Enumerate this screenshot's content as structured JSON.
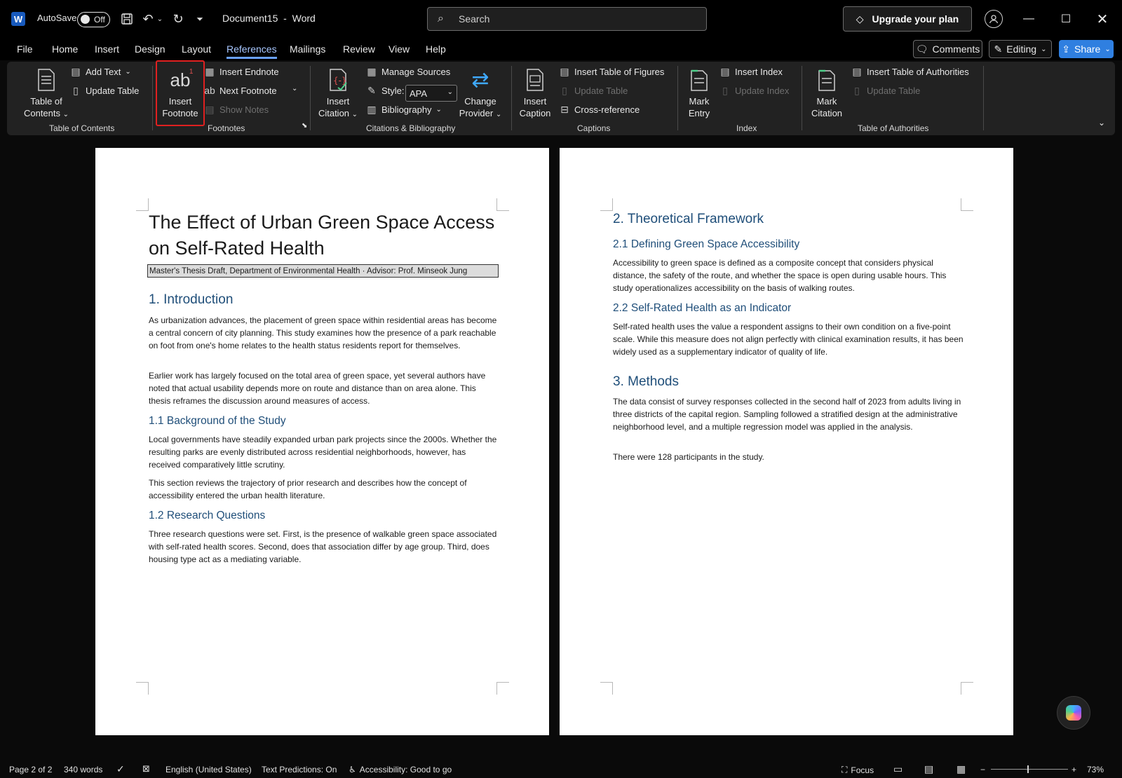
{
  "titlebar": {
    "app_letter": "W",
    "autosave_label": "AutoSave",
    "autosave_state": "Off",
    "document_name": "Document15",
    "separator": "-",
    "app_name": "Word",
    "search_placeholder": "Search",
    "upgrade_label": "Upgrade your plan"
  },
  "menu": {
    "tabs": [
      "File",
      "Home",
      "Insert",
      "Design",
      "Layout",
      "References",
      "Mailings",
      "Review",
      "View",
      "Help"
    ],
    "active_tab": "References",
    "comments_label": "Comments",
    "editing_label": "Editing",
    "share_label": "Share"
  },
  "ribbon": {
    "toc": {
      "table_of_contents": "Table of\nContents",
      "add_text": "Add Text",
      "update_table": "Update Table",
      "group": "Table of Contents"
    },
    "footnotes": {
      "insert_footnote": "Insert\nFootnote",
      "insert_endnote": "Insert Endnote",
      "next_footnote": "Next Footnote",
      "show_notes": "Show Notes",
      "group": "Footnotes"
    },
    "citations": {
      "insert_citation": "Insert\nCitation",
      "manage_sources": "Manage Sources",
      "style_label": "Style:",
      "style_value": "APA",
      "bibliography": "Bibliography",
      "change_provider": "Change\nProvider",
      "group": "Citations & Bibliography"
    },
    "captions": {
      "insert_caption": "Insert\nCaption",
      "insert_table_of_figures": "Insert Table of Figures",
      "update_table": "Update Table",
      "cross_reference": "Cross-reference",
      "group": "Captions"
    },
    "index": {
      "mark_entry": "Mark\nEntry",
      "insert_index": "Insert Index",
      "update_index": "Update Index",
      "group": "Index"
    },
    "authorities": {
      "mark_citation": "Mark\nCitation",
      "insert_table_of_authorities": "Insert Table of Authorities",
      "update_table": "Update Table",
      "group": "Table of Authorities"
    }
  },
  "page1": {
    "title_line1": "The Effect of Urban Green Space Access",
    "title_line2": "on Self-Rated Health",
    "subtitle": "Master's Thesis Draft, Department of Environmental Health · Advisor: Prof. Minseok Jung",
    "h_intro": "1. Introduction",
    "p_intro1": "As urbanization advances, the placement of green space within residential areas has become a central concern of city planning. This study examines how the presence of a park reachable on foot from one's home relates to the health status residents report for themselves.",
    "p_intro2": "Earlier work has largely focused on the total area of green space, yet several authors have noted that actual usability depends more on route and distance than on area alone. This thesis reframes the discussion around measures of access.",
    "h_background": "1.1 Background of the Study",
    "p_background1": "Local governments have steadily expanded urban park projects since the 2000s. Whether the resulting parks are evenly distributed across residential neighborhoods, however, has received comparatively little scrutiny.",
    "p_background2": "This section reviews the trajectory of prior research and describes how the concept of accessibility entered the urban health literature.",
    "h_questions": "1.2 Research Questions",
    "p_questions": "Three research questions were set. First, is the presence of walkable green space associated with self-rated health scores. Second, does that association differ by age group. Third, does housing type act as a mediating variable."
  },
  "page2": {
    "h_framework": "2. Theoretical Framework",
    "h_defining": "2.1 Defining Green Space Accessibility",
    "p_defining": "Accessibility to green space is defined as a composite concept that considers physical distance, the safety of the route, and whether the space is open during usable hours. This study operationalizes accessibility on the basis of walking routes.",
    "h_indicator": "2.2 Self-Rated Health as an Indicator",
    "p_indicator": "Self-rated health uses the value a respondent assigns to their own condition on a five-point scale. While this measure does not align perfectly with clinical examination results, it has been widely used as a supplementary indicator of quality of life.",
    "h_methods": "3. Methods",
    "p_methods": "The data consist of survey responses collected in the second half of 2023 from adults living in three districts of the capital region. Sampling followed a stratified design at the administrative neighborhood level, and a multiple regression model was applied in the analysis.",
    "p_participants": "There were 128 participants in the study."
  },
  "status": {
    "page": "Page 2 of 2",
    "words": "340 words",
    "language": "English (United States)",
    "predictions": "Text Predictions: On",
    "accessibility": "Accessibility: Good to go",
    "focus": "Focus",
    "zoom": "73%",
    "zoom_minus": "−",
    "zoom_plus": "+"
  },
  "colors": {
    "accent": "#6aa1ff",
    "heading": "#1f4e79",
    "highlight": "#e02020",
    "share": "#2f7fe0"
  }
}
